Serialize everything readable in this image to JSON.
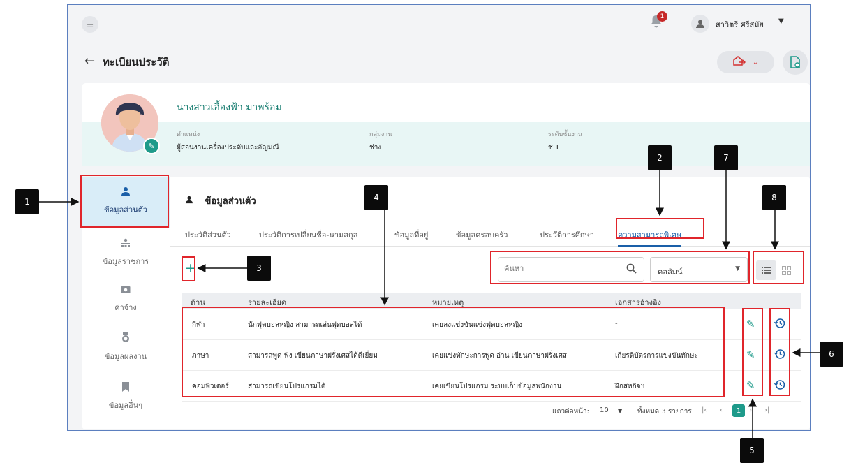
{
  "topbar": {
    "menu_icon": "collapse-menu-icon",
    "notification_count": "1",
    "user_name": "สาวิตรี ศรีสมัย"
  },
  "header": {
    "title": "ทะเบียนประวัติ"
  },
  "profile": {
    "name": "นางสาวเอื้องฟ้า มาพร้อม",
    "position_label": "ตำแหน่ง",
    "position_value": "ผู้สอนงานเครื่องประดับและอัญมณี",
    "group_label": "กลุ่มงาน",
    "group_value": "ช่าง",
    "level_label": "ระดับชั้นงาน",
    "level_value": "ช 1"
  },
  "sidebar": {
    "items": [
      {
        "label": "ข้อมูลส่วนตัว",
        "icon": "person-icon"
      },
      {
        "label": "ข้อมูลราชการ",
        "icon": "org-icon"
      },
      {
        "label": "ค่าจ้าง",
        "icon": "money-icon"
      },
      {
        "label": "ข้อมูลผลงาน",
        "icon": "medal-icon"
      },
      {
        "label": "ข้อมูลอื่นๆ",
        "icon": "bookmark-icon"
      }
    ]
  },
  "panel": {
    "title": "ข้อมูลส่วนตัว",
    "tabs": [
      {
        "label": "ประวัติส่วนตัว"
      },
      {
        "label": "ประวัติการเปลี่ยนชื่อ-นามสกุล"
      },
      {
        "label": "ข้อมูลที่อยู่"
      },
      {
        "label": "ข้อมูลครอบครัว"
      },
      {
        "label": "ประวัติการศึกษา"
      },
      {
        "label": "ความสามารถพิเศษ"
      }
    ],
    "add_label": "+",
    "search_placeholder": "ค้นหา",
    "column_select": "คอลัมน์"
  },
  "table": {
    "headers": [
      "ด้าน",
      "รายละเอียด",
      "หมายเหตุ",
      "เอกสารอ้างอิง"
    ],
    "rows": [
      {
        "area": "กีฬา",
        "detail": "นักฟุตบอลหญิง สามารถเล่นฟุตบอลได้",
        "note": "เคยลงแข่งขันแข่งฟุตบอลหญิง",
        "ref": "-"
      },
      {
        "area": "ภาษา",
        "detail": "สามารถพูด ฟัง เขียนภาษาฝรั่งเศสได้ดีเยี่ยม",
        "note": "เคยแข่งทักษะการพูด อ่าน เขียนภาษาฝรั่งเศส",
        "ref": "เกียรติบัตรการแข่งขันทักษะ"
      },
      {
        "area": "คอมพิวเตอร์",
        "detail": "สามารถเขียนโปรแกรมได้",
        "note": "เคยเขียนโปรแกรม ระบบเก็บข้อมูลพนักงาน",
        "ref": "ฝึกสหกิจฯ"
      }
    ]
  },
  "pager": {
    "rows_per_page_label": "แถวต่อหน้า:",
    "rows_per_page": "10",
    "total_label": "ทั้งหมด 3 รายการ",
    "current_page": "1"
  },
  "callouts": [
    "1",
    "2",
    "3",
    "4",
    "5",
    "6",
    "7",
    "8"
  ],
  "colors": {
    "accent": "#1e9a8a",
    "active_tab": "#1a5fa8",
    "highlight": "#e0252b"
  }
}
